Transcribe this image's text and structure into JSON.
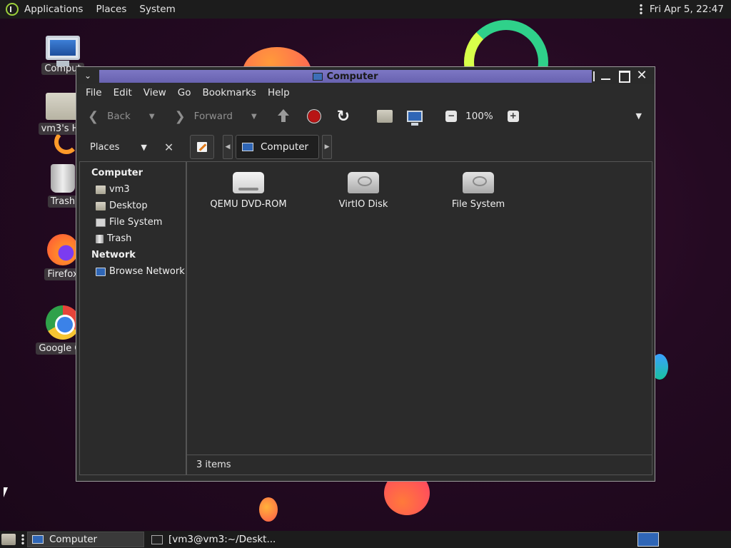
{
  "top_panel": {
    "menus": [
      "Applications",
      "Places",
      "System"
    ],
    "clock": "Fri Apr  5, 22:47"
  },
  "desktop": {
    "icons": [
      {
        "label": "Comput",
        "icon": "computer-icon"
      },
      {
        "label": "vm3's Ho",
        "icon": "home-folder-icon"
      },
      {
        "label": "Trash",
        "icon": "trash-icon"
      },
      {
        "label": "Firefox",
        "icon": "firefox-icon"
      },
      {
        "label": "Google Ch",
        "icon": "chrome-icon"
      }
    ]
  },
  "window": {
    "title": "Computer",
    "menubar": [
      "File",
      "Edit",
      "View",
      "Go",
      "Bookmarks",
      "Help"
    ],
    "toolbar": {
      "back_label": "Back",
      "forward_label": "Forward",
      "zoom_level": "100%",
      "zoom_out_glyph": "−",
      "zoom_in_glyph": "+"
    },
    "sidebar": {
      "header": "Places",
      "sections": [
        {
          "title": "Computer",
          "items": [
            {
              "label": "vm3",
              "icon": "home-icon"
            },
            {
              "label": "Desktop",
              "icon": "desktop-icon"
            },
            {
              "label": "File System",
              "icon": "filesystem-icon"
            },
            {
              "label": "Trash",
              "icon": "trash-icon"
            }
          ]
        },
        {
          "title": "Network",
          "items": [
            {
              "label": "Browse Network",
              "icon": "network-icon"
            }
          ]
        }
      ]
    },
    "pathbar": {
      "crumb": "Computer"
    },
    "items": [
      {
        "label": "QEMU DVD-ROM",
        "icon": "optical-drive-icon"
      },
      {
        "label": "VirtIO Disk",
        "icon": "hard-disk-icon"
      },
      {
        "label": "File System",
        "icon": "hard-disk-icon"
      }
    ],
    "status": "3 items"
  },
  "taskbar": {
    "tasks": [
      {
        "label": "Computer",
        "active": true
      },
      {
        "label": "[vm3@vm3:~/Deskt...",
        "active": false
      }
    ]
  },
  "colors": {
    "title_accent": "#6862b0",
    "panel_bg": "#1c1c1c",
    "window_bg": "#2b2b2b",
    "desktop_bg": "#240a22"
  }
}
